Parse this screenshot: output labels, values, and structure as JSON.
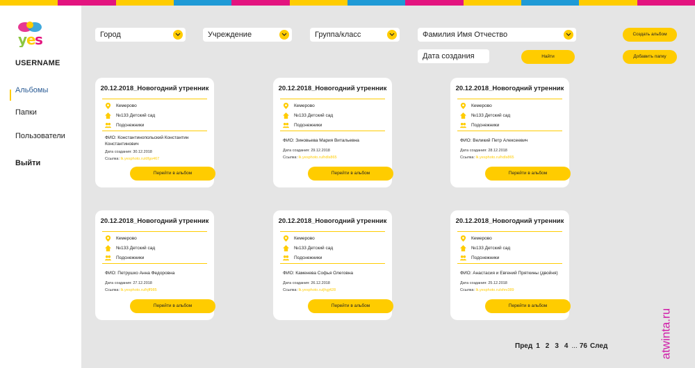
{
  "brand": {
    "logo_text": "yes",
    "stripe_colors": [
      "#ffcc00",
      "#e3147f",
      "#ffcc00",
      "#1f9ad6",
      "#e3147f",
      "#ffcc00",
      "#1f9ad6",
      "#e3147f",
      "#ffcc00",
      "#1f9ad6",
      "#ffcc00",
      "#e3147f"
    ]
  },
  "sidebar": {
    "username": "USERNAME",
    "items": [
      {
        "label": "Альбомы",
        "active": true
      },
      {
        "label": "Папки"
      },
      {
        "label": "Пользователи"
      }
    ],
    "logout": "Выйти"
  },
  "filters": {
    "city": "Город",
    "institution": "Учреждение",
    "group": "Группа/класс",
    "fio": "Фамилия Имя Отчество",
    "created": "Дата создания",
    "find_button": "Найти"
  },
  "actions": {
    "create_album": "Создать альбом",
    "add_folder": "Добавить папку"
  },
  "cards": [
    {
      "title": "20.12.2018_Новогодний утренник",
      "city": "Кемерово",
      "school": "№133 Детский сад",
      "group": "Подснежники",
      "fio": "ФИО: Константинопольский Константин Константинович",
      "date_label": "Дата создания: ",
      "date": "30.12.2018",
      "link_label": "Ссылка: ",
      "link": "lk.yesphoto.ru/dfgo467",
      "button": "Перейти в альбом"
    },
    {
      "title": "20.12.2018_Новогодний утренник",
      "city": "Кемерово",
      "school": "№133 Детский сад",
      "group": "Подснежники",
      "fio": "ФИО: Зиновьева Мария Витальевна",
      "date_label": "Дата создания: ",
      "date": "29.12.2018",
      "link_label": "Ссылка: ",
      "link": "lk.yesphoto.ru/hdls865",
      "button": "Перейти в альбом"
    },
    {
      "title": "20.12.2018_Новогодний утренник",
      "city": "Кемерово",
      "school": "№133 Детский сад",
      "group": "Подснежники",
      "fio": "ФИО: Великий Петр Алексеевич",
      "date_label": "Дата создания: ",
      "date": "28.12.2018",
      "link_label": "Ссылка: ",
      "link": "lk.yesphoto.ru/hdls865",
      "button": "Перейти в альбом"
    },
    {
      "title": "20.12.2018_Новогодний утренник",
      "city": "Кемерово",
      "school": "№133 Детский сад",
      "group": "Подснежники",
      "fio": "ФИО: Петрушко Анна Федоровна",
      "date_label": "Дата создания: ",
      "date": "27.12.2018",
      "link_label": "Ссылка: ",
      "link": "lk.yesphoto.ru/hjff985",
      "button": "Перейти в альбом"
    },
    {
      "title": "20.12.2018_Новогодний утренник",
      "city": "Кемерово",
      "school": "№133 Детский сад",
      "group": "Подснежники",
      "fio": "ФИО: Каменева Софья Олеговна",
      "date_label": "Дата создания: ",
      "date": "26.12.2018",
      "link_label": "Ссылка: ",
      "link": "lk.yesphoto.ru/jhgj428",
      "button": "Перейти в альбом"
    },
    {
      "title": "20.12.2018_Новогодний утренник",
      "city": "Кемерово",
      "school": "№133 Детский сад",
      "group": "Подснежники",
      "fio": "ФИО: Анастасия и Евгений Пряткины (двойня)",
      "date_label": "Дата создания: ",
      "date": "25.12.2018",
      "link_label": "Ссылка: ",
      "link": "lk.yesphoto.ru/sfev389",
      "button": "Перейти в альбом"
    }
  ],
  "pagination": {
    "prev": "Пред",
    "pages": [
      "1",
      "2",
      "3",
      "4"
    ],
    "ellipsis": "...",
    "last": "76",
    "next": "След"
  },
  "watermark": "atwinta.ru"
}
